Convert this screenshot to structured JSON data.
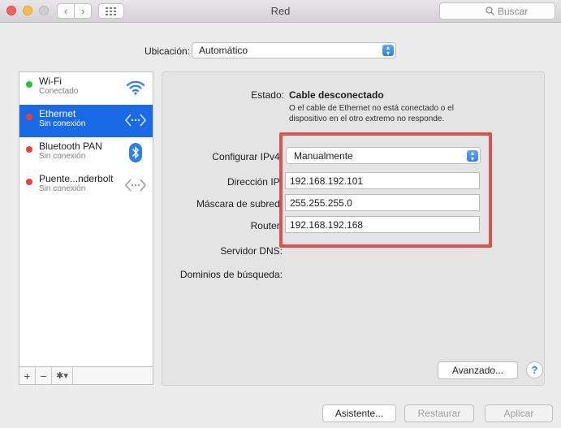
{
  "window": {
    "title": "Red",
    "search_placeholder": "Buscar",
    "nav_back": "‹",
    "nav_forward": "›",
    "grid_glyph": "⋮⋮⋮"
  },
  "location": {
    "label": "Ubicación:",
    "value": "Automático"
  },
  "services": [
    {
      "name": "Wi-Fi",
      "status": "Conectado",
      "icon": "wifi-icon"
    },
    {
      "name": "Ethernet",
      "status": "Sin conexión",
      "icon": "ethernet-icon",
      "selected": true
    },
    {
      "name": "Bluetooth PAN",
      "status": "Sin conexión",
      "icon": "bluetooth-icon"
    },
    {
      "name": "Puente...nderbolt",
      "status": "Sin conexión",
      "icon": "thunderbolt-bridge-icon"
    }
  ],
  "sidebar_tools": {
    "add": "+",
    "remove": "−",
    "gear": "✱▾"
  },
  "detail": {
    "state_label": "Estado:",
    "state_value": "Cable desconectado",
    "state_desc": "O el cable de Ethernet no está conectado o el dispositivo en el otro extremo no responde.",
    "ipv4_label": "Configurar IPv4:",
    "ipv4_value": "Manualmente",
    "ip_label": "Dirección IP:",
    "ip_value": "192.168.192.101",
    "mask_label": "Máscara de subred:",
    "mask_value": "255.255.255.0",
    "router_label": "Router:",
    "router_value": "192.168.192.168",
    "dns_label": "Servidor DNS:",
    "domains_label": "Dominios de búsqueda:"
  },
  "buttons": {
    "advanced": "Avanzado...",
    "help": "?",
    "assistant": "Asistente...",
    "revert": "Restaurar",
    "apply": "Aplicar"
  },
  "colors": {
    "selection": "#1a6ae6",
    "highlight": "#d9534f",
    "connected": "#29c13c",
    "disconnected": "#e8413b"
  }
}
